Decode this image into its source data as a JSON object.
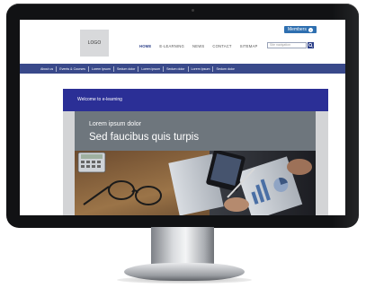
{
  "header": {
    "members_label": "Members",
    "logo_text": "LOGO",
    "nav": [
      "HOME",
      "E-LEARNING",
      "NEWS",
      "CONTACT",
      "SITEMAP"
    ],
    "search_placeholder": "Site navigation"
  },
  "subnav": [
    "About us",
    "Events & Courses",
    "Lorem Ipsum",
    "Sedum dolor",
    "Lorem ipsum",
    "Sedum dolor",
    "Lorem Ipsum",
    "Sedum dolor"
  ],
  "content": {
    "welcome": "Welcome to e-learning",
    "hero_small": "Lorem ipsum dolor",
    "hero_big": "Sed faucibus quis turpis"
  },
  "colors": {
    "nav_bar": "#39498a",
    "welcome_bar": "#2b2f96",
    "members_badge": "#2e6fb0",
    "hero_panel": "#6e767d"
  }
}
